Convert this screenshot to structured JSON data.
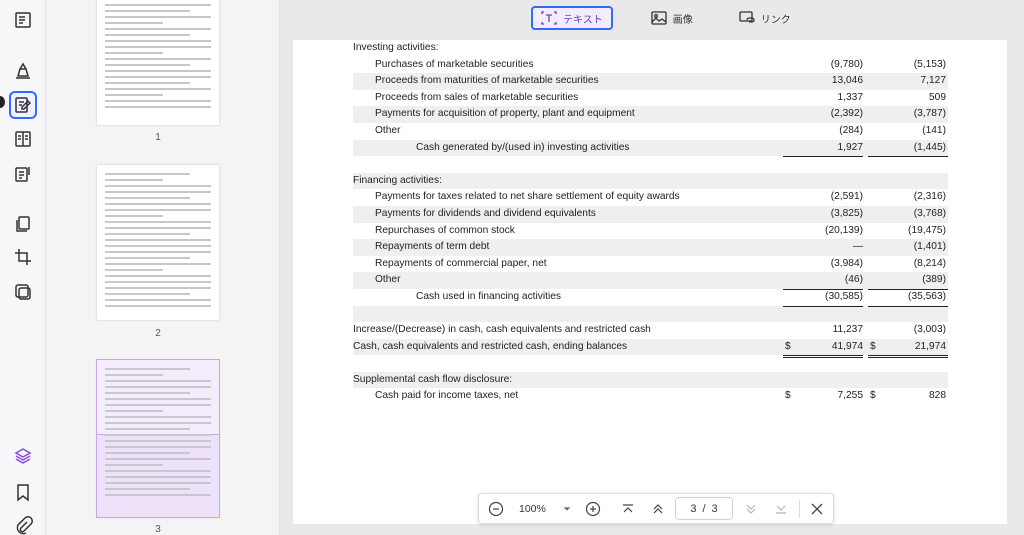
{
  "modes": [
    {
      "label": "テキスト",
      "icon": "text-mode-icon",
      "active": true
    },
    {
      "label": "画像",
      "icon": "image-mode-icon",
      "active": false
    },
    {
      "label": "リンク",
      "icon": "link-mode-icon",
      "active": false
    }
  ],
  "thumbnails": [
    {
      "number": "1"
    },
    {
      "number": "2"
    },
    {
      "number": "3",
      "selected": true
    }
  ],
  "statement": {
    "investing": {
      "heading": "Investing activities:",
      "rows": [
        {
          "label": "Purchases of marketable securities",
          "c1": "(9,780)",
          "c2": "(5,153)"
        },
        {
          "label": "Proceeds from maturities of marketable securities",
          "c1": "13,046",
          "c2": "7,127"
        },
        {
          "label": "Proceeds from sales of marketable securities",
          "c1": "1,337",
          "c2": "509"
        },
        {
          "label": "Payments for acquisition of property, plant and equipment",
          "c1": "(2,392)",
          "c2": "(3,787)"
        },
        {
          "label": "Other",
          "c1": "(284)",
          "c2": "(141)"
        }
      ],
      "total": {
        "label": "Cash generated by/(used in) investing activities",
        "c1": "1,927",
        "c2": "(1,445)"
      }
    },
    "financing": {
      "heading": "Financing activities:",
      "rows": [
        {
          "label": "Payments for taxes related to net share settlement of equity awards",
          "c1": "(2,591)",
          "c2": "(2,316)"
        },
        {
          "label": "Payments for dividends and dividend equivalents",
          "c1": "(3,825)",
          "c2": "(3,768)"
        },
        {
          "label": "Repurchases of common stock",
          "c1": "(20,139)",
          "c2": "(19,475)"
        },
        {
          "label": "Repayments of term debt",
          "c1": "—",
          "c2": "(1,401)"
        },
        {
          "label": "Repayments of commercial paper, net",
          "c1": "(3,984)",
          "c2": "(8,214)"
        },
        {
          "label": "Other",
          "c1": "(46)",
          "c2": "(389)"
        }
      ],
      "total": {
        "label": "Cash used in financing activities",
        "c1": "(30,585)",
        "c2": "(35,563)"
      }
    },
    "change": {
      "label": "Increase/(Decrease) in cash, cash equivalents and restricted cash",
      "c1": "11,237",
      "c2": "(3,003)"
    },
    "ending": {
      "label": "Cash, cash equivalents and restricted cash, ending balances",
      "currency": "$",
      "c1": "41,974",
      "c2": "21,974"
    },
    "supplemental": {
      "heading": "Supplemental cash flow disclosure:",
      "row": {
        "label": "Cash paid for income taxes, net",
        "currency": "$",
        "c1": "7,255",
        "c2": "828"
      }
    }
  },
  "navbar": {
    "zoom": "100%",
    "current_page": "3",
    "separator": "/",
    "total_pages": "3"
  }
}
